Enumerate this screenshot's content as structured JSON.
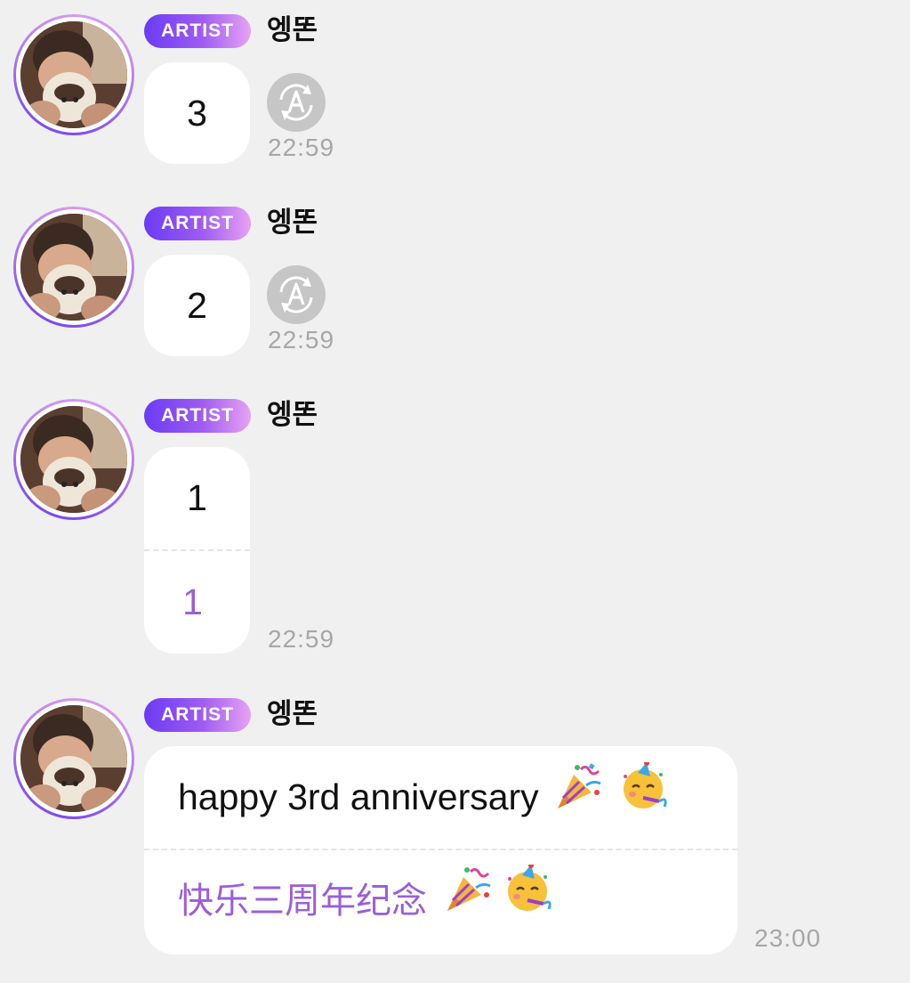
{
  "artist_badge": "ARTIST",
  "sender_name": "엥똔",
  "messages": [
    {
      "text": "3",
      "time": "22:59",
      "translate_icon": "translate-a-icon"
    },
    {
      "text": "2",
      "time": "22:59",
      "translate_icon": "translate-a-icon"
    },
    {
      "text": "1",
      "translation": "1",
      "time": "22:59"
    },
    {
      "text": "happy 3rd anniversary",
      "translation": "快乐三周年纪念",
      "emojis": [
        "party-popper-icon",
        "partying-face-icon"
      ],
      "time": "23:00"
    }
  ],
  "colors": {
    "background": "#f0f0f0",
    "bubble": "#ffffff",
    "translation_text": "#9a5fd9",
    "timestamp": "#a7a7a7",
    "badge_start": "#6a3bf4",
    "badge_end": "#e7a2f3"
  }
}
